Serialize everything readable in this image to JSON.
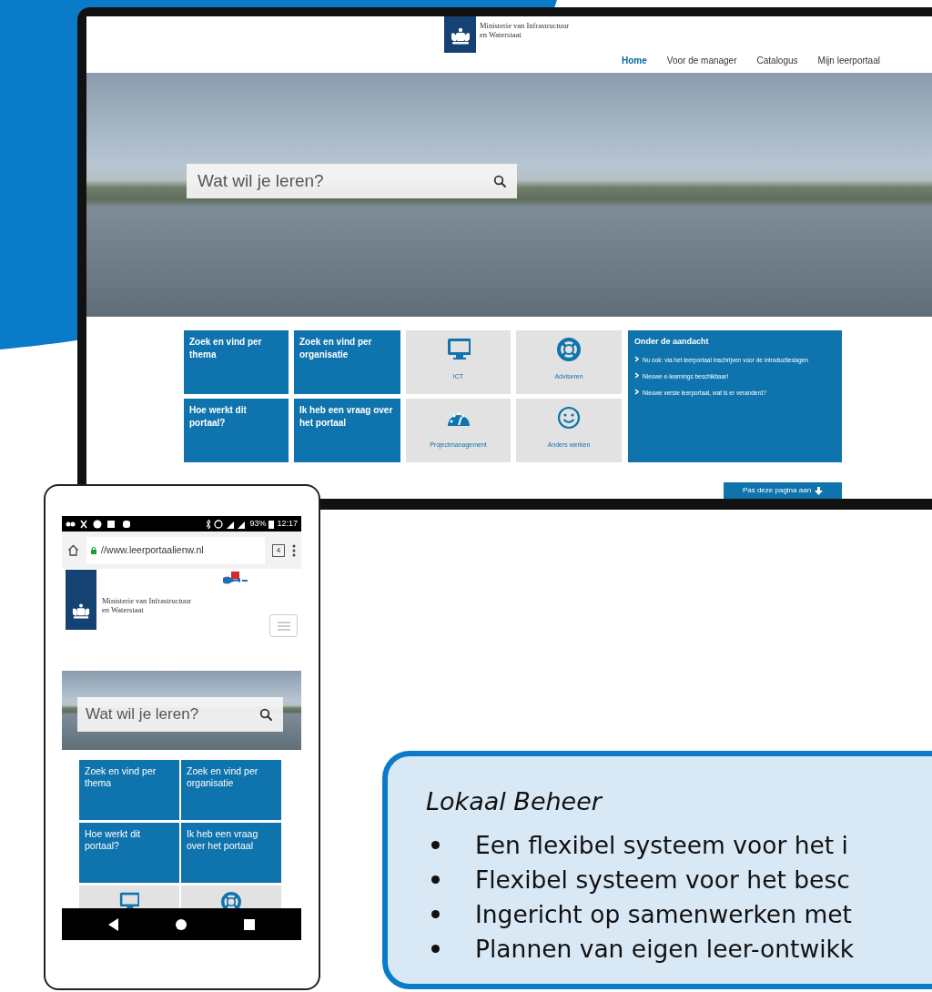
{
  "desktop": {
    "logo": {
      "lines": [
        "Ministerie van Infrastructuur",
        "en Waterstaat"
      ]
    },
    "nav": [
      {
        "label": "Home",
        "selected": true
      },
      {
        "label": "Voor de manager",
        "selected": false
      },
      {
        "label": "Catalogus",
        "selected": false
      },
      {
        "label": "Mijn leerportaal",
        "selected": false
      }
    ],
    "search": {
      "placeholder": "Wat wil je leren?"
    },
    "tiles": [
      {
        "kind": "text",
        "label": "Zoek en vind per thema"
      },
      {
        "kind": "text",
        "label": "Zoek en vind per organisatie"
      },
      {
        "kind": "icon",
        "label": "ICT"
      },
      {
        "kind": "icon",
        "label": "Adviseren"
      },
      {
        "kind": "text",
        "label": "Hoe werkt dit portaal?"
      },
      {
        "kind": "text",
        "label": "Ik heb een vraag over het portaal"
      },
      {
        "kind": "icon",
        "label": "Projectmanagement"
      },
      {
        "kind": "icon",
        "label": "Anders werken"
      }
    ],
    "news": {
      "title": "Onder de aandacht",
      "items": [
        "Nu ook: via het leerportaal inschrijven voor de introductiedagen",
        "Nieuwe e-learnings beschikbaar!",
        "Nieuwe versie leerportaal, wat is er veranderd?"
      ]
    },
    "button": "Pas deze pagina aan"
  },
  "phone": {
    "status_bar": {
      "battery": "93%",
      "time": "12:17"
    },
    "address_bar": {
      "url": "//www.leerportaalienw.nl",
      "tab_count": "4"
    },
    "logo": {
      "lines": [
        "Ministerie van Infrastructuur",
        "en Waterstaat"
      ]
    },
    "search": {
      "placeholder": "Wat wil je leren?"
    },
    "tiles": [
      {
        "kind": "text",
        "label": "Zoek en vind per thema"
      },
      {
        "kind": "text",
        "label": "Zoek en vind per organisatie"
      },
      {
        "kind": "text",
        "label": "Hoe werkt dit portaal?"
      },
      {
        "kind": "text",
        "label": "Ik heb een vraag over het portaal"
      },
      {
        "kind": "icon"
      },
      {
        "kind": "icon"
      }
    ]
  },
  "callout": {
    "title": "Lokaal Beheer",
    "items": [
      "Een flexibel systeem voor het i",
      "Flexibel systeem voor het besc",
      "Ingericht op samenwerken met",
      "Plannen van eigen leer-ontwikk"
    ]
  }
}
